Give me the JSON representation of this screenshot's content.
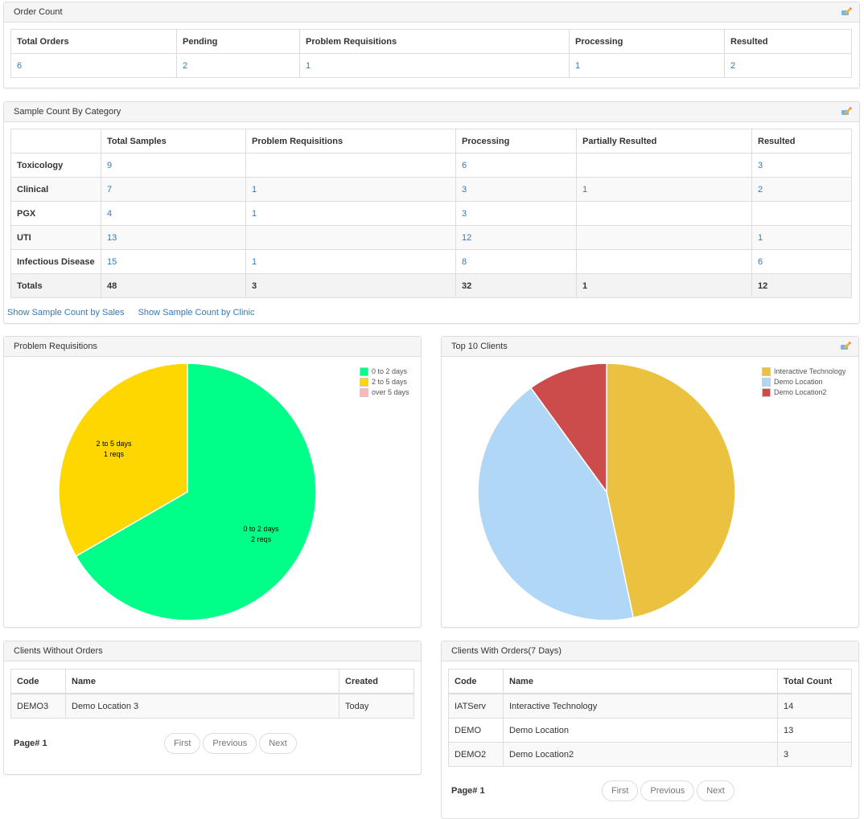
{
  "order_count": {
    "title": "Order Count",
    "headers": [
      "Total Orders",
      "Pending",
      "Problem Requisitions",
      "Processing",
      "Resulted"
    ],
    "values": [
      "6",
      "2",
      "1",
      "1",
      "2"
    ]
  },
  "sample_count": {
    "title": "Sample Count By Category",
    "headers": [
      "",
      "Total Samples",
      "Problem Requisitions",
      "Processing",
      "Partially Resulted",
      "Resulted"
    ],
    "rows": [
      [
        "Toxicology",
        "9",
        "",
        "6",
        "",
        "3"
      ],
      [
        "Clinical",
        "7",
        "1",
        "3",
        "1",
        "2"
      ],
      [
        "PGX",
        "4",
        "1",
        "3",
        "",
        ""
      ],
      [
        "UTI",
        "13",
        "",
        "12",
        "",
        "1"
      ],
      [
        "Infectious Disease",
        "15",
        "1",
        "8",
        "",
        "6"
      ]
    ],
    "totals": [
      "Totals",
      "48",
      "3",
      "32",
      "1",
      "12"
    ],
    "links": [
      "Show Sample Count by Sales",
      "Show Sample Count by Clinic"
    ]
  },
  "chart_data": [
    {
      "type": "pie",
      "title": "Problem Requisitions",
      "categories": [
        "0 to 2 days",
        "2 to 5 days",
        "over 5 days"
      ],
      "values": [
        2,
        1,
        0
      ],
      "colors": [
        "#00ff88",
        "#ffd700",
        "#ffb6b6"
      ],
      "slice_labels": [
        [
          "0 to 2 days",
          "2 reqs"
        ],
        [
          "2 to 5 days",
          "1 reqs"
        ],
        [
          "",
          ""
        ]
      ],
      "legend": "top-right"
    },
    {
      "type": "pie",
      "title": "Top 10 Clients",
      "categories": [
        "Interactive Technology",
        "Demo Location",
        "Demo Location2"
      ],
      "values": [
        14,
        13,
        3
      ],
      "colors": [
        "#ebc23f",
        "#b0d7f5",
        "#cc4b4b"
      ],
      "legend": "top-right"
    }
  ],
  "clients_without_orders": {
    "title": "Clients Without Orders",
    "headers": [
      "Code",
      "Name",
      "Created"
    ],
    "rows": [
      [
        "DEMO3",
        "Demo Location 3",
        "Today"
      ]
    ],
    "page_label": "Page# 1",
    "pager": [
      "First",
      "Previous",
      "Next"
    ]
  },
  "clients_with_orders": {
    "title": "Clients With Orders(7 Days)",
    "headers": [
      "Code",
      "Name",
      "Total Count"
    ],
    "rows": [
      [
        "IATServ",
        "Interactive Technology",
        "14"
      ],
      [
        "DEMO",
        "Demo Location",
        "13"
      ],
      [
        "DEMO2",
        "Demo Location2",
        "3"
      ]
    ],
    "page_label": "Page# 1",
    "pager": [
      "First",
      "Previous",
      "Next"
    ]
  },
  "icons": {
    "edit": "pencil-edit-icon"
  }
}
